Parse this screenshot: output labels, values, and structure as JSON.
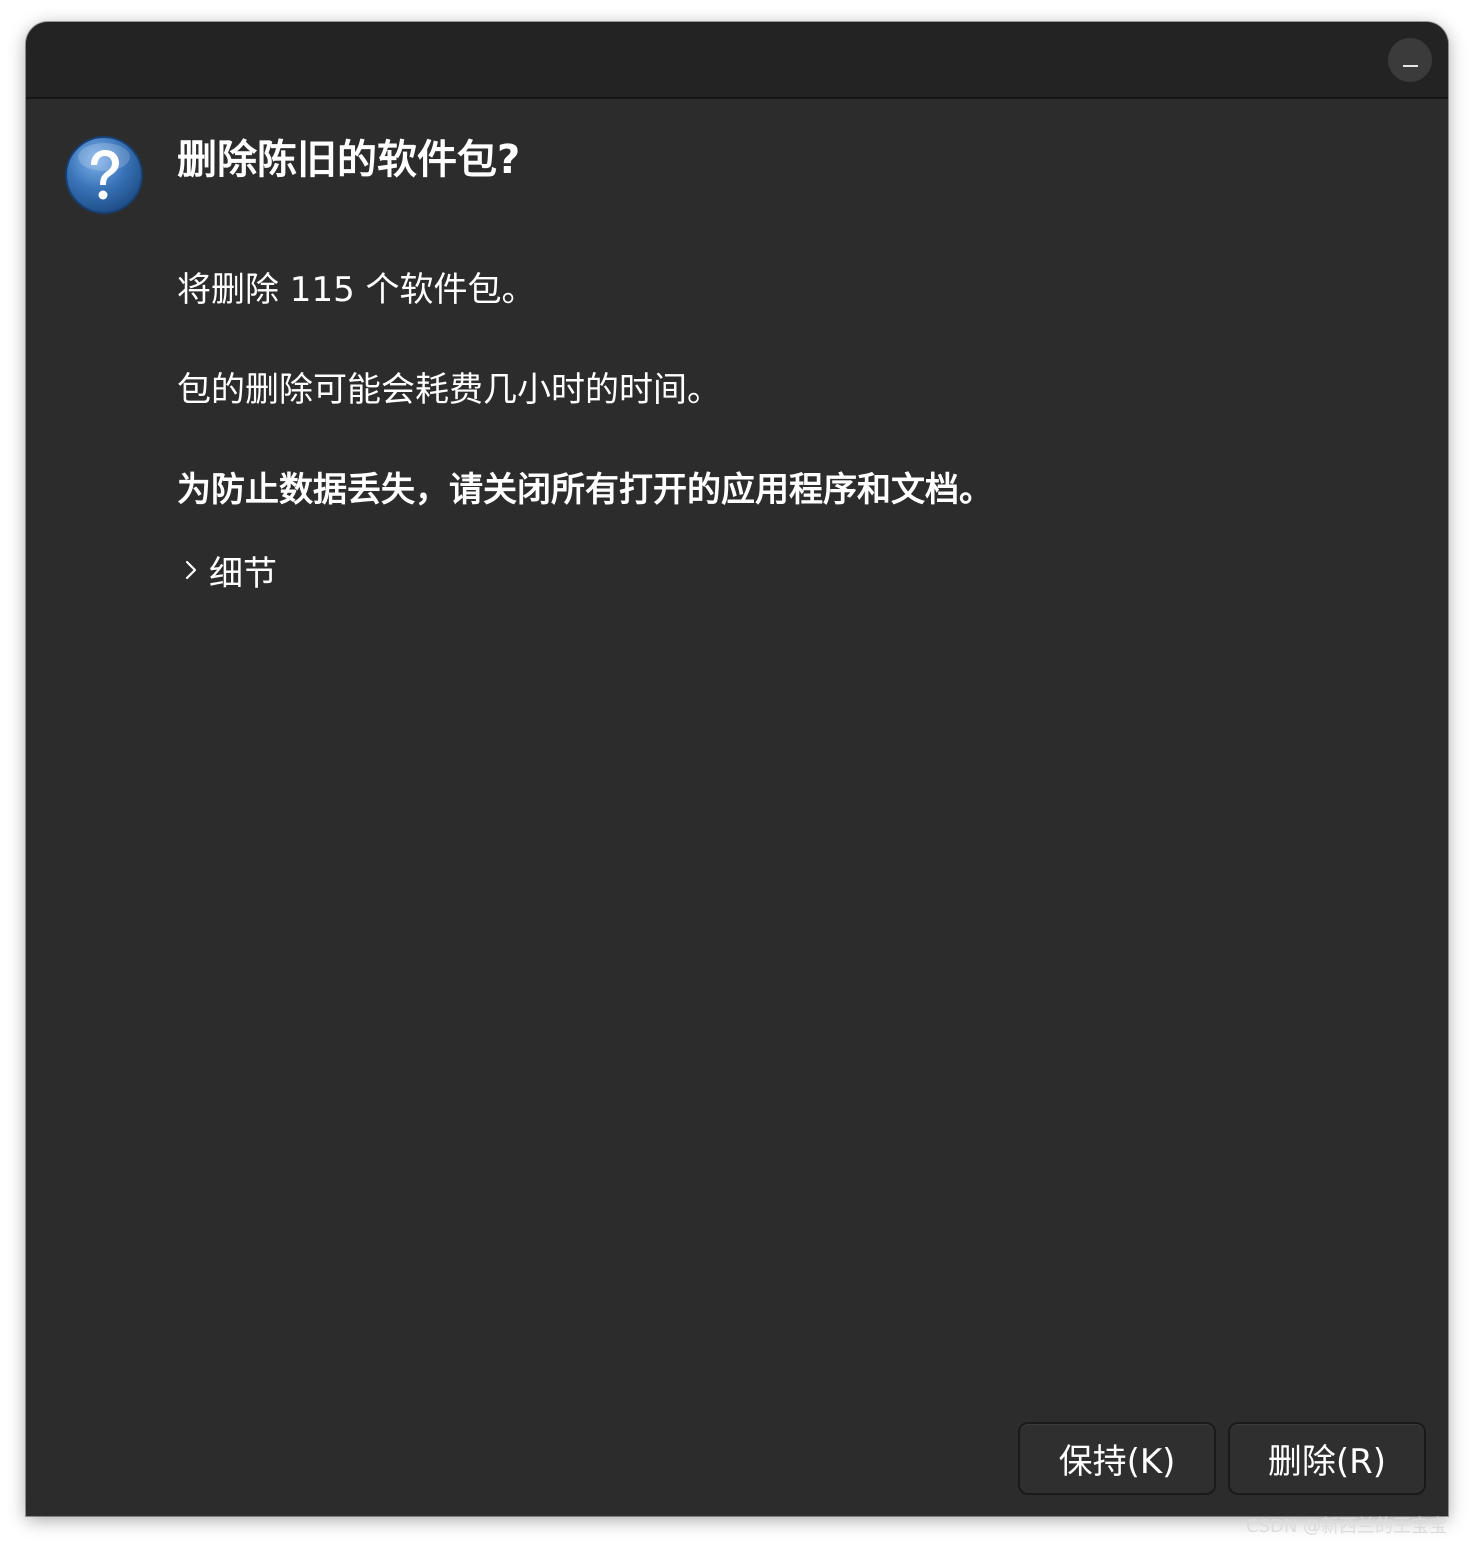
{
  "window": {
    "minimize_label": "–"
  },
  "dialog": {
    "title": "删除陈旧的软件包?",
    "count_text": "将删除 115 个软件包。",
    "duration_text": "包的删除可能会耗费几小时的时间。",
    "warning_text": "为防止数据丢失，请关闭所有打开的应用程序和文档。",
    "details_label": "细节"
  },
  "buttons": {
    "keep_label": "保持(K)",
    "remove_label": "删除(R)"
  },
  "watermark": "CSDN @新西兰的王宝宝",
  "colors": {
    "window_bg": "#2c2c2c",
    "titlebar_bg": "#232323",
    "text": "#ffffff",
    "icon_blue": "#3a74b8"
  },
  "icons": {
    "dialog_icon": "question-icon",
    "details_toggle": "chevron-right-icon"
  }
}
